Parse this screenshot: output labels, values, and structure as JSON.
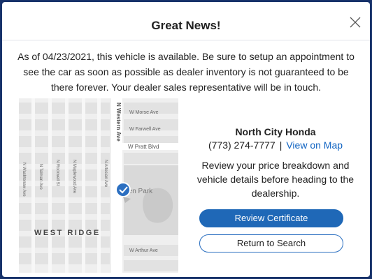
{
  "modal": {
    "title": "Great News!",
    "message": "As of 04/23/2021, this vehicle is available. Be sure to setup an appointment to see the car as soon as possible as dealer inventory is not guaranteed to be there forever. Your dealer sales representative will be in touch.",
    "close_icon": "close-icon"
  },
  "map": {
    "streets": {
      "w_morse": "W Morse Ave",
      "w_farwell": "W Farwell Ave",
      "w_pratt": "W Pratt Blvd",
      "w_arthur": "W Arthur Ave",
      "n_western": "N Western Ave",
      "n_washtenaw": "N Washtenaw Ave",
      "n_talman": "N Talman Ave",
      "n_rockwell": "N Rockwell St",
      "n_maplewood": "N Maplewood Ave",
      "n_artesian": "N Artesian Ave"
    },
    "park_label": "rren Park",
    "neighborhood": "WEST RIDGE",
    "pin_icon": "map-pin-check-icon"
  },
  "dealer": {
    "name": "North City Honda",
    "phone": "(773) 274-7777",
    "separator": "|",
    "map_link": "View on Map",
    "review_text": "Review your price breakdown and vehicle details before heading to the dealership."
  },
  "buttons": {
    "review": "Review Certificate",
    "return": "Return to Search"
  },
  "colors": {
    "frame": "#17326a",
    "primary": "#1f68b7",
    "link": "#0f63c2"
  }
}
